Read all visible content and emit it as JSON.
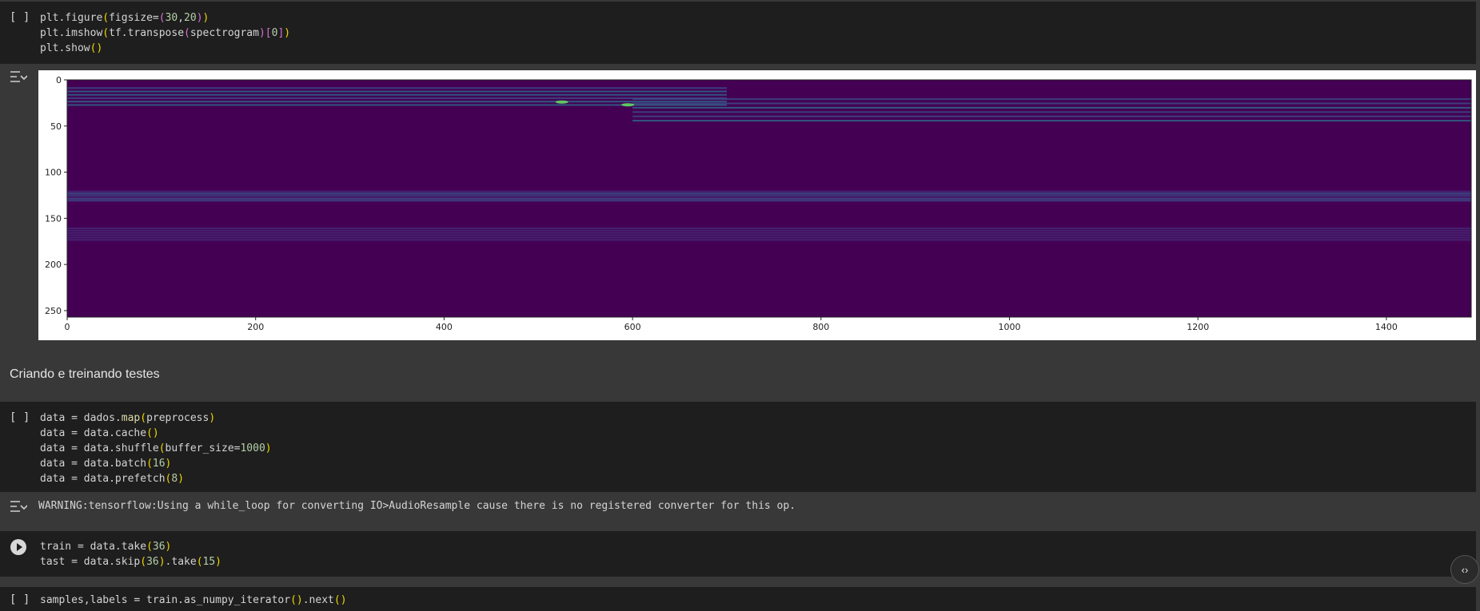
{
  "cells": {
    "cell1": {
      "gutter": "[ ]",
      "lines": [
        [
          {
            "t": "plt.figure"
          },
          {
            "t": "(",
            "c": "paren"
          },
          {
            "t": "figsize="
          },
          {
            "t": "(",
            "c": "paren2"
          },
          {
            "t": "30",
            "c": "num"
          },
          {
            "t": ","
          },
          {
            "t": "20",
            "c": "num"
          },
          {
            "t": ")",
            "c": "paren2"
          },
          {
            "t": ")",
            "c": "paren"
          }
        ],
        [
          {
            "t": "plt.imshow"
          },
          {
            "t": "(",
            "c": "paren"
          },
          {
            "t": "tf.transpose"
          },
          {
            "t": "(",
            "c": "paren2"
          },
          {
            "t": "spectrogram"
          },
          {
            "t": ")",
            "c": "paren2"
          },
          {
            "t": "[",
            "c": "paren2"
          },
          {
            "t": "0",
            "c": "num"
          },
          {
            "t": "]",
            "c": "paren2"
          },
          {
            "t": ")",
            "c": "paren"
          }
        ],
        [
          {
            "t": "plt.show"
          },
          {
            "t": "()",
            "c": "paren"
          }
        ]
      ]
    },
    "heading": "Criando e treinando testes",
    "cell2": {
      "gutter": "[ ]",
      "lines": [
        [
          {
            "t": "data = dados."
          },
          {
            "t": "map",
            "c": "fn"
          },
          {
            "t": "(",
            "c": "paren"
          },
          {
            "t": "preprocess"
          },
          {
            "t": ")",
            "c": "paren"
          }
        ],
        [
          {
            "t": "data = data.cache"
          },
          {
            "t": "()",
            "c": "paren"
          }
        ],
        [
          {
            "t": "data = data.shuffle"
          },
          {
            "t": "(",
            "c": "paren"
          },
          {
            "t": "buffer_size="
          },
          {
            "t": "1000",
            "c": "num"
          },
          {
            "t": ")",
            "c": "paren"
          }
        ],
        [
          {
            "t": "data = data.batch"
          },
          {
            "t": "(",
            "c": "paren"
          },
          {
            "t": "16",
            "c": "num"
          },
          {
            "t": ")",
            "c": "paren"
          }
        ],
        [
          {
            "t": "data = data.prefetch"
          },
          {
            "t": "(",
            "c": "paren"
          },
          {
            "t": "8",
            "c": "num"
          },
          {
            "t": ")",
            "c": "paren"
          }
        ]
      ],
      "warning": "WARNING:tensorflow:Using a while_loop for converting IO>AudioResample cause there is no registered converter for this op."
    },
    "cell3": {
      "lines": [
        [
          {
            "t": "train = data.take"
          },
          {
            "t": "(",
            "c": "paren"
          },
          {
            "t": "36",
            "c": "num"
          },
          {
            "t": ")",
            "c": "paren"
          }
        ],
        [
          {
            "t": "tast = data.skip"
          },
          {
            "t": "(",
            "c": "paren"
          },
          {
            "t": "36",
            "c": "num"
          },
          {
            "t": ")",
            "c": "paren"
          },
          {
            "t": ".take"
          },
          {
            "t": "(",
            "c": "paren"
          },
          {
            "t": "15",
            "c": "num"
          },
          {
            "t": ")",
            "c": "paren"
          }
        ]
      ]
    },
    "cell4": {
      "gutter": "[ ]",
      "lines": [
        [
          {
            "t": "samples,labels = train.as_numpy_iterator"
          },
          {
            "t": "()",
            "c": "paren"
          },
          {
            "t": ".next"
          },
          {
            "t": "()",
            "c": "paren"
          }
        ]
      ]
    }
  },
  "float_button": {
    "icon": "code-icon",
    "label": "‹›"
  },
  "colors": {
    "cell_bg": "#1e1e1e",
    "page_bg": "#383838",
    "paren": "#f1d700",
    "num": "#b5cea8",
    "viridis_low": "#440154",
    "viridis_high": "#fde725"
  },
  "chart_data": {
    "type": "heatmap",
    "title": "",
    "xlabel": "",
    "ylabel": "",
    "xlim": [
      0,
      1490
    ],
    "ylim": [
      257,
      0
    ],
    "xticks": [
      "0",
      "200",
      "400",
      "600",
      "800",
      "1000",
      "1200",
      "1400"
    ],
    "yticks": [
      "0",
      "50",
      "100",
      "150",
      "200",
      "250"
    ],
    "colormap": "viridis",
    "bands": [
      {
        "y_from": 8,
        "y_to": 30,
        "intensity": 0.55,
        "x_from": 0,
        "x_to": 700
      },
      {
        "y_from": 20,
        "y_to": 48,
        "intensity": 0.45,
        "x_from": 600,
        "x_to": 1490
      },
      {
        "y_from": 120,
        "y_to": 132,
        "intensity": 0.35,
        "x_from": 0,
        "x_to": 1490
      },
      {
        "y_from": 160,
        "y_to": 175,
        "intensity": 0.2,
        "x_from": 0,
        "x_to": 1490
      }
    ],
    "hotspots": [
      {
        "x": 525,
        "y": 24
      },
      {
        "x": 595,
        "y": 27
      }
    ]
  }
}
